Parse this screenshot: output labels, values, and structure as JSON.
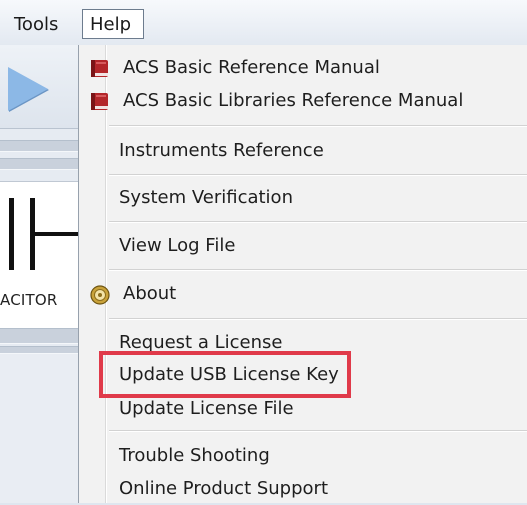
{
  "menubar": {
    "tools_label": "Tools",
    "help_label": "Help"
  },
  "background": {
    "component_label": "ACITOR"
  },
  "help_menu": {
    "items": [
      {
        "label": "ACS Basic Reference Manual",
        "icon": "book-icon"
      },
      {
        "label": "ACS Basic Libraries Reference Manual",
        "icon": "book-icon"
      },
      {
        "label": "Instruments Reference"
      },
      {
        "label": "System Verification"
      },
      {
        "label": "View Log File"
      },
      {
        "label": "About",
        "icon": "about-icon"
      },
      {
        "label": "Request a License"
      },
      {
        "label": "Update USB License Key",
        "highlighted": true
      },
      {
        "label": "Update License File"
      },
      {
        "label": "Trouble Shooting"
      },
      {
        "label": "Online Product Support"
      }
    ]
  },
  "colors": {
    "highlight_border": "#e03a4a",
    "book_red": "#b3262a",
    "about_gold": "#c9a23a"
  }
}
